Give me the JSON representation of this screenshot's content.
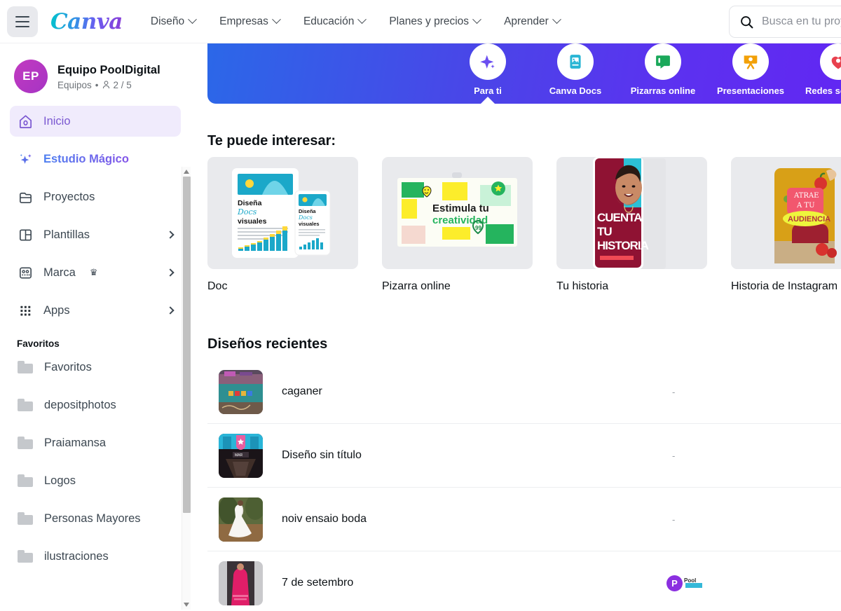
{
  "topnav": {
    "menu_icon": "hamburger-icon",
    "logo_text": "Canva",
    "items": [
      {
        "label": "Diseño",
        "icon": "chevron-down-icon"
      },
      {
        "label": "Empresas",
        "icon": "chevron-down-icon"
      },
      {
        "label": "Educación",
        "icon": "chevron-down-icon"
      },
      {
        "label": "Planes y precios",
        "icon": "chevron-down-icon"
      },
      {
        "label": "Aprender",
        "icon": "chevron-down-icon"
      }
    ],
    "search": {
      "icon": "search-icon",
      "placeholder": "Busca en tu proyecto",
      "value": ""
    }
  },
  "sidebar": {
    "team": {
      "initials": "EP",
      "name": "Equipo PoolDigital",
      "meta_prefix": "Equipos",
      "separator": "•",
      "members_icon": "person-icon",
      "members": "2 / 5"
    },
    "nav": [
      {
        "label": "Inicio",
        "icon": "home-icon",
        "active": true,
        "expandable": false
      },
      {
        "label": "Estudio Mágico",
        "icon": "sparkle-icon",
        "active": false,
        "expandable": false
      },
      {
        "label": "Proyectos",
        "icon": "projects-folder-icon",
        "active": false,
        "expandable": false
      },
      {
        "label": "Plantillas",
        "icon": "templates-icon",
        "active": false,
        "expandable": true
      },
      {
        "label": "Marca",
        "icon": "brand-icon",
        "active": false,
        "expandable": true,
        "badge": "crown-icon"
      },
      {
        "label": "Apps",
        "icon": "apps-grid-icon",
        "active": false,
        "expandable": true
      }
    ],
    "favorites_label": "Favoritos",
    "favorites": [
      {
        "label": "Favoritos",
        "icon": "folder-icon"
      },
      {
        "label": "depositphotos",
        "icon": "folder-icon"
      },
      {
        "label": "Praiamansa",
        "icon": "folder-icon"
      },
      {
        "label": "Logos",
        "icon": "folder-icon"
      },
      {
        "label": "Personas Mayores",
        "icon": "folder-icon"
      },
      {
        "label": "ilustraciones",
        "icon": "folder-icon"
      }
    ],
    "scrollbar": {
      "up_icon": "scroll-up-arrow-icon",
      "down_icon": "scroll-down-arrow-icon"
    }
  },
  "banner": {
    "categories": [
      {
        "label": "Para ti",
        "icon": "sparkle-icon",
        "color": "#6b4ef0",
        "selected": true
      },
      {
        "label": "Canva Docs",
        "icon": "docs-image-icon",
        "color": "#29b5d4",
        "selected": false
      },
      {
        "label": "Pizarras online",
        "icon": "whiteboard-icon",
        "color": "#1aa85a",
        "selected": false
      },
      {
        "label": "Presentaciones",
        "icon": "presentation-icon",
        "color": "#f2a007",
        "selected": false
      },
      {
        "label": "Redes sociales",
        "icon": "social-heart-icon",
        "color": "#e8414e",
        "selected": false
      }
    ]
  },
  "main": {
    "suggestions_title": "Te puede interesar:",
    "suggestions": [
      {
        "caption": "Doc",
        "thumb": "doc-template-thumb",
        "t1": "Diseña",
        "t2": "Docs",
        "t3": "visuales"
      },
      {
        "caption": "Pizarra online",
        "thumb": "whiteboard-template-thumb",
        "t1": "Estimula tu",
        "t2": "creatividad"
      },
      {
        "caption": "Tu historia",
        "thumb": "story-template-thumb",
        "t1": "CUENTA",
        "t2": "TU",
        "t3": "HISTORIA"
      },
      {
        "caption": "Historia de Instagram",
        "thumb": "instagram-story-thumb",
        "t1": "ATRAE",
        "t2": "A TU",
        "t3": "AUDIENCIA"
      }
    ],
    "recent_title": "Diseños recientes",
    "recent": [
      {
        "name": "caganer",
        "thumb": "caganer-thumb",
        "meta": "-",
        "owner": null
      },
      {
        "name": "Diseño sin título",
        "thumb": "untitled-design-thumb",
        "meta": "-",
        "owner": null
      },
      {
        "name": "noiv ensaio boda",
        "thumb": "noiv-ensaio-boda-thumb",
        "meta": "-",
        "owner": null
      },
      {
        "name": "7 de setembro",
        "thumb": "7-de-setembro-thumb",
        "meta": "",
        "owner": {
          "initial": "P",
          "brand": "Pool"
        }
      }
    ]
  },
  "colors": {
    "accent_purple": "#7a57d1",
    "active_bg": "#f0ebfc",
    "banner_from": "#2b68e8",
    "banner_to": "#6226f2",
    "avatar": "#c23ac0"
  }
}
